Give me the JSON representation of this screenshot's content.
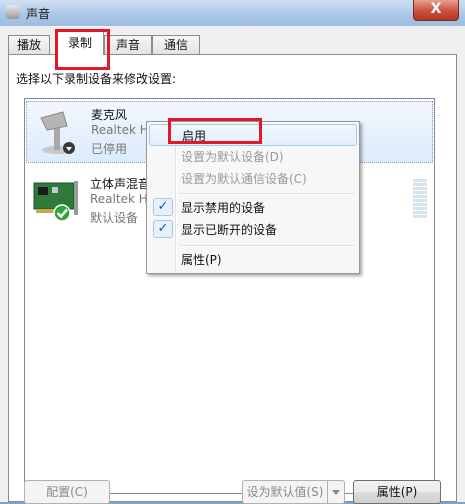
{
  "window": {
    "title": "声音",
    "close_label": "X"
  },
  "tabs": [
    {
      "label": "播放"
    },
    {
      "label": "录制"
    },
    {
      "label": "声音"
    },
    {
      "label": "通信"
    }
  ],
  "instruction": "选择以下录制设备来修改设置:",
  "devices": [
    {
      "name": "麦克风",
      "driver": "Realtek H",
      "status": "已停用",
      "icon": "microphone-icon"
    },
    {
      "name": "立体声混音",
      "driver": "Realtek H",
      "status": "默认设备",
      "icon": "sound-card-icon"
    }
  ],
  "context_menu": {
    "items": [
      {
        "label": "启用",
        "state": "hover"
      },
      {
        "label": "设置为默认设备(D)",
        "state": "disabled"
      },
      {
        "label": "设置为默认通信设备(C)",
        "state": "disabled"
      },
      {
        "label": "显示禁用的设备",
        "checked": true
      },
      {
        "label": "显示已断开的设备",
        "checked": true
      },
      {
        "label": "属性(P)"
      }
    ]
  },
  "buttons": {
    "configure": "配置(C)",
    "set_default": "设为默认值(S)",
    "properties": "属性(P)"
  },
  "colors": {
    "highlight_box": "#e3172a",
    "check": "#1a57b8"
  }
}
